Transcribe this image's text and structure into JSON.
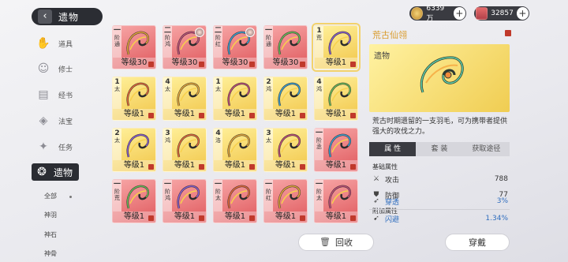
{
  "header": {
    "back_icon": "chevron-left-icon",
    "title": "遗物"
  },
  "currencies": [
    {
      "icon": "gold-coin-icon",
      "value": "6339万"
    },
    {
      "icon": "ticket-icon",
      "value": "32857"
    }
  ],
  "sidebar": {
    "items": [
      {
        "label": "道具",
        "icon": "hand-icon"
      },
      {
        "label": "修士",
        "icon": "person-icon"
      },
      {
        "label": "经书",
        "icon": "book-icon"
      },
      {
        "label": "法宝",
        "icon": "treasure-icon"
      },
      {
        "label": "任务",
        "icon": "task-icon"
      },
      {
        "label": "遗物",
        "icon": "relic-icon",
        "active": true
      }
    ],
    "subitems": [
      "全部",
      "神羽",
      "神石",
      "神骨"
    ]
  },
  "grid": {
    "rows": [
      [
        {
          "color": "red",
          "tag_num": "一",
          "tag_label": "阶",
          "tag_sub": "通",
          "level": "等级30"
        },
        {
          "color": "red",
          "tag_num": "二",
          "tag_label": "阶",
          "tag_sub": "鸿",
          "level": "等级30",
          "avatar": true
        },
        {
          "color": "red",
          "tag_num": "二",
          "tag_label": "阶",
          "tag_sub": "红",
          "level": "等级30",
          "avatar": true
        },
        {
          "color": "red",
          "tag_num": "一",
          "tag_label": "阶",
          "tag_sub": "通",
          "level": "等级30"
        },
        {
          "color": "yellow",
          "tag_num": "1",
          "tag_label": "",
          "tag_sub": "荒",
          "level": "等级1",
          "selected": true
        }
      ],
      [
        {
          "color": "yellow",
          "tag_num": "1",
          "tag_label": "",
          "tag_sub": "太",
          "level": "等级1"
        },
        {
          "color": "yellow",
          "tag_num": "4",
          "tag_label": "",
          "tag_sub": "太",
          "level": "等级1"
        },
        {
          "color": "yellow",
          "tag_num": "1",
          "tag_label": "",
          "tag_sub": "太",
          "level": "等级1"
        },
        {
          "color": "yellow",
          "tag_num": "2",
          "tag_label": "",
          "tag_sub": "鸿",
          "level": "等级1"
        },
        {
          "color": "yellow",
          "tag_num": "4",
          "tag_label": "",
          "tag_sub": "鸿",
          "level": "等级1"
        }
      ],
      [
        {
          "color": "yellow",
          "tag_num": "2",
          "tag_label": "",
          "tag_sub": "太",
          "level": "等级1"
        },
        {
          "color": "yellow",
          "tag_num": "3",
          "tag_label": "",
          "tag_sub": "鸿",
          "level": "等级1"
        },
        {
          "color": "yellow",
          "tag_num": "4",
          "tag_label": "",
          "tag_sub": "洛",
          "level": "等级1"
        },
        {
          "color": "yellow",
          "tag_num": "3",
          "tag_label": "",
          "tag_sub": "太",
          "level": "等级1"
        },
        {
          "color": "red",
          "tag_num": "一",
          "tag_label": "阶",
          "tag_sub": "丞",
          "level": "等级1"
        }
      ],
      [
        {
          "color": "red",
          "tag_num": "一",
          "tag_label": "阶",
          "tag_sub": "荒",
          "level": "等级1"
        },
        {
          "color": "red",
          "tag_num": "一",
          "tag_label": "阶",
          "tag_sub": "鸿",
          "level": "等级1"
        },
        {
          "color": "red",
          "tag_num": "一",
          "tag_label": "阶",
          "tag_sub": "太",
          "level": "等级1"
        },
        {
          "color": "red",
          "tag_num": "一",
          "tag_label": "阶",
          "tag_sub": "红",
          "level": "等级1"
        },
        {
          "color": "red",
          "tag_num": "一",
          "tag_label": "阶",
          "tag_sub": "太",
          "level": "等级1"
        }
      ]
    ]
  },
  "detail": {
    "name": "荒古仙翎",
    "category": "遗物",
    "description": "荒古时期遗留的一支羽毛，可为携带者提供强大的攻伐之力。",
    "tabs": [
      "属 性",
      "套 装",
      "获取途径"
    ],
    "base_title": "基础属性",
    "base_stats": [
      {
        "icon": "sword-icon",
        "label": "攻击",
        "value": "788"
      },
      {
        "icon": "shield-icon",
        "label": "防御",
        "value": "77"
      }
    ],
    "extra_title": "附加属性",
    "extra_stats": [
      {
        "icon": "pierce-icon",
        "label": "穿透",
        "value": "3%"
      },
      {
        "icon": "dodge-icon",
        "label": "闪避",
        "value": "1.34%"
      }
    ]
  },
  "buttons": {
    "recycle": "回收",
    "equip": "穿戴"
  }
}
